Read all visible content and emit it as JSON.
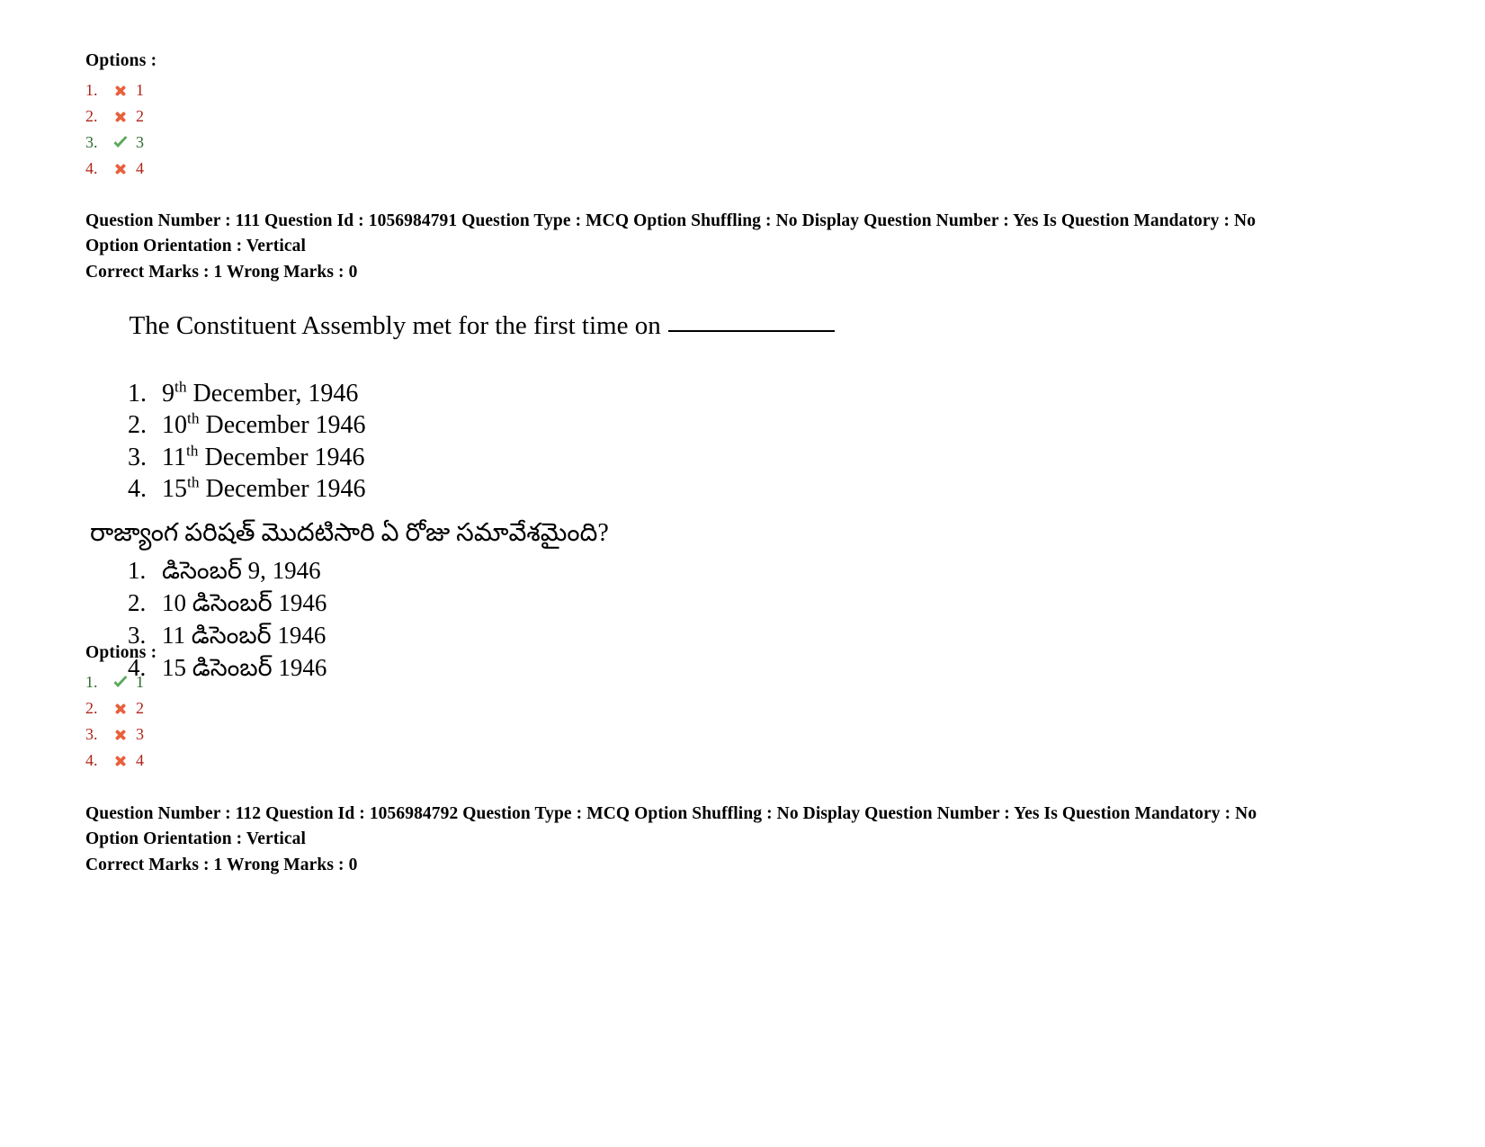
{
  "document": {
    "page_background": "#ffffff",
    "correct_color": "#2f6b2f",
    "wrong_color": "#b02418",
    "check_icon_color": "#5ba85b",
    "cross_icon_color": "#e8603c"
  },
  "options_block_top": {
    "title": "Options :",
    "rows": [
      {
        "num": "1.",
        "mark": "cross-icon",
        "value": "1",
        "state": "wrong"
      },
      {
        "num": "2.",
        "mark": "cross-icon",
        "value": "2",
        "state": "wrong"
      },
      {
        "num": "3.",
        "mark": "check-icon",
        "value": "3",
        "state": "right"
      },
      {
        "num": "4.",
        "mark": "cross-icon",
        "value": "4",
        "state": "wrong"
      }
    ]
  },
  "question_111": {
    "meta_line_1": "Question Number : 111 Question Id : 1056984791 Question Type : MCQ Option Shuffling : No Display Question Number : Yes Is Question Mandatory : No Option Orientation : Vertical",
    "meta_line_2": "Correct Marks : 1 Wrong Marks : 0",
    "english": {
      "stem_prefix": "The Constituent Assembly met for the first time on",
      "options": [
        {
          "num": "1.",
          "day": "9",
          "ord": "th",
          "rest": " December, 1946"
        },
        {
          "num": "2.",
          "day": "10",
          "ord": "th",
          "rest": " December 1946"
        },
        {
          "num": "3.",
          "day": "11",
          "ord": "th",
          "rest": " December 1946"
        },
        {
          "num": "4.",
          "day": "15",
          "ord": "th",
          "rest": " December 1946"
        }
      ]
    },
    "telugu": {
      "stem": "రాజ్యాంగ పరిషత్ మొదటిసారి ఏ రోజు సమావేశమైంది?",
      "options": [
        {
          "num": "1.",
          "text": "డిసెంబర్ 9, 1946"
        },
        {
          "num": "2.",
          "text": "10 డిసెంబర్ 1946"
        },
        {
          "num": "3.",
          "text": "11 డిసెంబర్ 1946"
        },
        {
          "num": "4.",
          "text": "15 డిసెంబర్ 1946"
        }
      ]
    }
  },
  "options_block_bottom": {
    "title": "Options :",
    "rows": [
      {
        "num": "1.",
        "mark": "check-icon",
        "value": "1",
        "state": "right"
      },
      {
        "num": "2.",
        "mark": "cross-icon",
        "value": "2",
        "state": "wrong"
      },
      {
        "num": "3.",
        "mark": "cross-icon",
        "value": "3",
        "state": "wrong"
      },
      {
        "num": "4.",
        "mark": "cross-icon",
        "value": "4",
        "state": "wrong"
      }
    ]
  },
  "question_112": {
    "meta_line_1": "Question Number : 112 Question Id : 1056984792 Question Type : MCQ Option Shuffling : No Display Question Number : Yes Is Question Mandatory : No Option Orientation : Vertical",
    "meta_line_2": "Correct Marks : 1 Wrong Marks : 0"
  }
}
